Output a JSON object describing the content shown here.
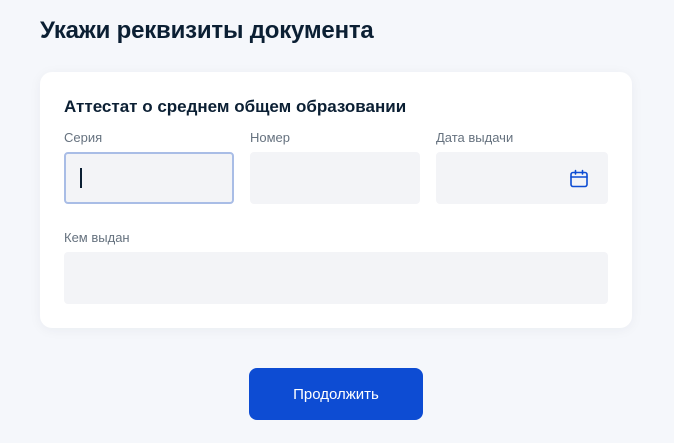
{
  "page": {
    "title": "Укажи реквизиты документа"
  },
  "form": {
    "title": "Аттестат о среднем общем образовании",
    "fields": {
      "series": {
        "label": "Серия",
        "value": ""
      },
      "number": {
        "label": "Номер",
        "value": ""
      },
      "issue_date": {
        "label": "Дата выдачи",
        "value": "",
        "icon": "calendar-icon"
      },
      "issued_by": {
        "label": "Кем выдан",
        "value": ""
      }
    }
  },
  "actions": {
    "continue_label": "Продолжить"
  },
  "colors": {
    "primary_button": "#0d4cd3",
    "field_background": "#f3f4f7",
    "active_field_border": "#a9bde6",
    "page_background": "#f5f7fb"
  }
}
